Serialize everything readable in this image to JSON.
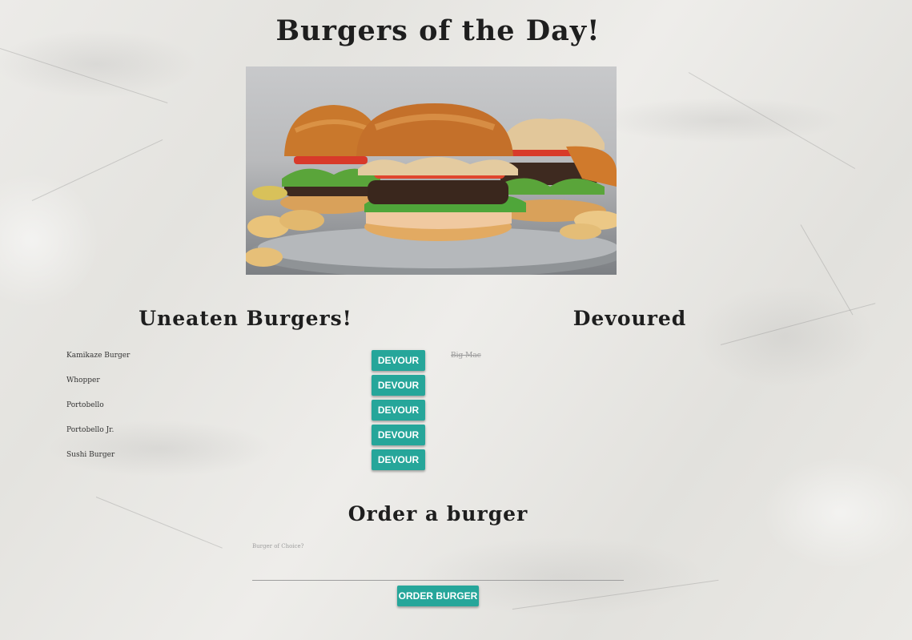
{
  "page": {
    "title": "Burgers of the Day!"
  },
  "hero": {
    "image": "burgers-photo"
  },
  "uneaten": {
    "heading": "Uneaten Burgers!",
    "button_label": "DEVOUR",
    "items": [
      {
        "name": "Kamikaze Burger"
      },
      {
        "name": "Whopper"
      },
      {
        "name": "Portobello"
      },
      {
        "name": "Portobello Jr."
      },
      {
        "name": "Sushi Burger"
      }
    ]
  },
  "devoured": {
    "heading": "Devoured",
    "items": [
      {
        "name": "Big Mac"
      }
    ]
  },
  "order": {
    "heading": "Order a burger",
    "field_label": "Burger of Choice?",
    "input_value": "",
    "button_label": "ORDER BURGER"
  },
  "colors": {
    "accent": "#26a69a",
    "background": "#e9e8e5",
    "text": "#1e1e1e"
  }
}
